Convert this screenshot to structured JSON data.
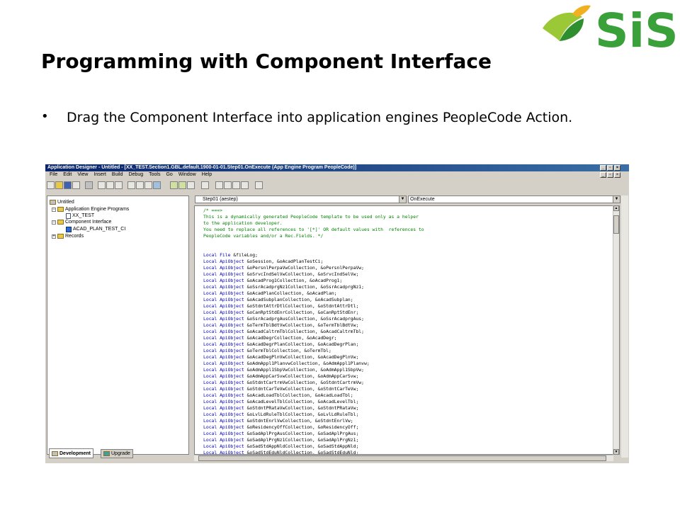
{
  "slide": {
    "title": "Programming with Component Interface",
    "bullet": "Drag the Component Interface into application engines PeopleCode Action."
  },
  "logo": {
    "text": "SiS",
    "brand_green": "#3aa03a",
    "leaf_colors": [
      "#9ac836",
      "#2f8f2f",
      "#f0b020"
    ]
  },
  "app": {
    "title": "Application Designer - Untitled - [XX_TEST.Section1.GBL.default.1900-01-01.Step01.OnExecute (App Engine Program PeopleCode)]",
    "menu": [
      "File",
      "Edit",
      "View",
      "Insert",
      "Build",
      "Debug",
      "Tools",
      "Go",
      "Window",
      "Help"
    ],
    "window_buttons": [
      "_",
      "▫",
      "×"
    ]
  },
  "tree": {
    "root": "Untitled",
    "folder1": "Application Engine Programs",
    "item1": "XX_TEST",
    "folder2": "Component Interface",
    "item2": "ACAD_PLAN_TEST_CI",
    "folder3": "Records"
  },
  "tabs": {
    "development": "Development",
    "upgrade": "Upgrade"
  },
  "editor": {
    "step_combo": "Step01  (aestep)",
    "event_combo": "OnExecute",
    "comment_lines": [
      "/* ===>",
      "This is a dynamically generated PeopleCode template to be used only as a helper",
      "to the application developer.",
      "You need to replace all references to '[*]' OR default values with  references to",
      "PeopleCode variables and/or a Rec.Fields. */"
    ],
    "decl_file": "File &fileLog;",
    "decls": [
      "ApiObject &oSession, &oAcadPlanTestCi;",
      "ApiObject &oPersnlPerpaVwCollection, &oPersnlPerpaVw;",
      "ApiObject &oSrvcIndSelVwCollection, &oSrvcIndSelVw;",
      "ApiObject &oAcadProg1Collection, &oAcadProg1;",
      "ApiObject &oSsrAcadprgNz1Collection, &oSsrAcadprgNz1;",
      "ApiObject &oAcadPlanCollection, &oAcadPlan;",
      "ApiObject &oAcadSubplanCollection, &oAcadSubplan;",
      "ApiObject &oStdntAttrDtlCollection, &oStdntAttrDtl;",
      "ApiObject &oCanRptStdEnrCollection, &oCanRptStdEnr;",
      "ApiObject &oSsrAcadprgAusCollection, &oSsrAcadprgAus;",
      "ApiObject &oTermTblBdtVwCollection, &oTermTblBdtVw;",
      "ApiObject &oAcadCaltrmTblCollection, &oAcadCaltrmTbl;",
      "ApiObject &oAcadDegrCollection, &oAcadDegr;",
      "ApiObject &oAcadDegrPlanCollection, &oAcadDegrPlan;",
      "ApiObject &oTermTblCollection, &oTermTbl;",
      "ApiObject &oAcadDegPlnVwCollection, &oAcadDegPlnVw;",
      "ApiObject &oAdmAppl1PlanvwCollection, &oAdmAppl1Planvw;",
      "ApiObject &oAdmAppl1SbpVwCollection, &oAdmAppl1SbpVw;",
      "ApiObject &oAdmAppCarSvwCollection, &oAdmAppCarSvw;",
      "ApiObject &oStdntCartrmVwCollection, &oStdntCartrmVw;",
      "ApiObject &oStdntCarTeVwCollection, &oStdntCarTeVw;",
      "ApiObject &oAcadLoadTblCollection, &oAcadLoadTbl;",
      "ApiObject &oAcadLevelTblCollection, &oAcadLevelTbl;",
      "ApiObject &oStdntPRataVwCollection, &oStdntPRataVw;",
      "ApiObject &oLvlLdRuleTblCollection, &oLvlLdRuleTbl;",
      "ApiObject &oStdntEnrlVwCollection, &oStdntEnrlVw;",
      "ApiObject &oResidencyOffCollection, &oResidencyOff;",
      "ApiObject &oSadAplPrgAusCollection, &oSadAplPrgAus;",
      "ApiObject &oSadAplPrgNz1Collection, &oSadAplPrgNz1;",
      "ApiObject &oSadStdAppNldCollection, &oSadStdAppNld;",
      "ApiObject &oSadStdEduNldCollection, &oSadStdEduNld;"
    ]
  }
}
